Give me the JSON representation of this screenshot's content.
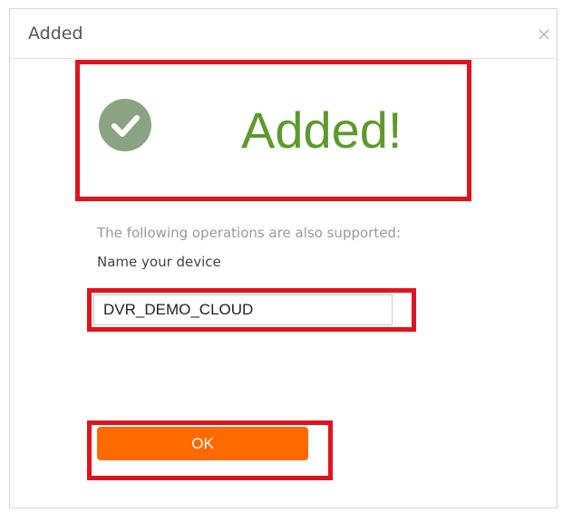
{
  "dialog": {
    "title": "Added",
    "close_icon": "close-icon"
  },
  "status": {
    "icon": "check-circle-icon",
    "message": "Added!",
    "color": "#5c9a2a"
  },
  "form": {
    "hint": "The following operations are also supported:",
    "name_label": "Name your device",
    "name_value": "DVR_DEMO_CLOUD"
  },
  "actions": {
    "ok_label": "OK"
  },
  "colors": {
    "highlight": "#e0131d",
    "ok_button": "#ff6a00",
    "check_circle": "#8aa382"
  }
}
